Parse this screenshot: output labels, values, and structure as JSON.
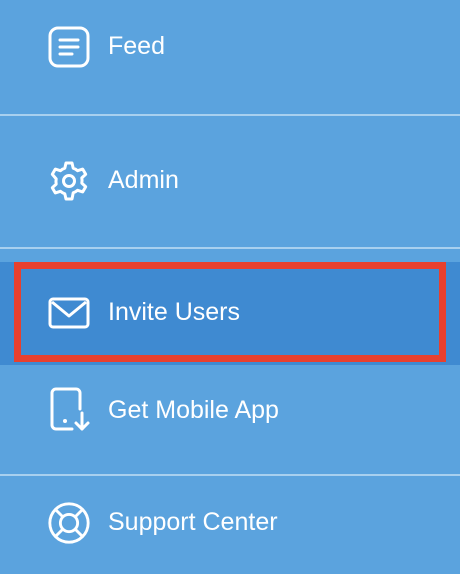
{
  "sidebar": {
    "items": [
      {
        "label": "Feed",
        "icon": "feed-icon"
      },
      {
        "label": "Admin",
        "icon": "gear-icon"
      },
      {
        "label": "Invite Users",
        "icon": "envelope-icon",
        "active": true
      },
      {
        "label": "Get Mobile App",
        "icon": "mobile-download-icon"
      },
      {
        "label": "Support Center",
        "icon": "lifebuoy-icon"
      }
    ]
  },
  "colors": {
    "background": "#5ba3de",
    "active_background": "#3f8ad1",
    "divider": "#a8d0ef",
    "highlight": "#e8402e",
    "text": "#ffffff"
  }
}
